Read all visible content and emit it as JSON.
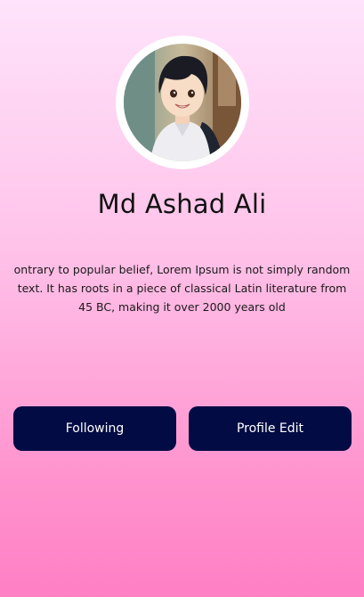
{
  "profile": {
    "name": "Md Ashad Ali",
    "bio": "ontrary to popular belief, Lorem Ipsum is not simply random text. It has roots in a piece of classical Latin literature from 45 BC, making it over 2000 years old"
  },
  "actions": {
    "following_label": "Following",
    "edit_label": "Profile Edit"
  },
  "colors": {
    "button_bg": "#020b44",
    "button_text": "#ffffff",
    "background_top": "#fee3fb",
    "background_bottom": "#ff7fc4"
  }
}
